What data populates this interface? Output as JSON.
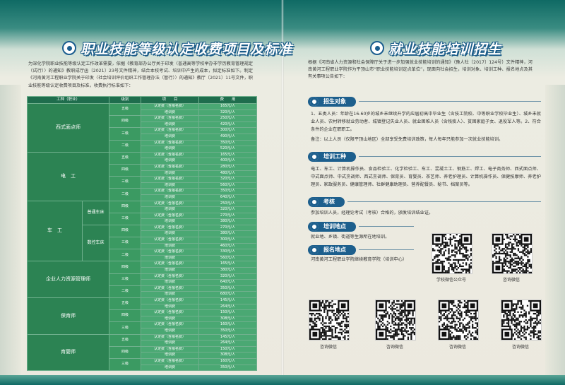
{
  "left": {
    "title": "职业技能等级认定收费项目及标准",
    "intro": "为深化学院职业技能等级认定工作改革需要，依据《教育部办公厅关于印发〈普通高等学校举办非学历教育管理规定（试行）〉的通知》教职成厅函〔2021〕23号文件精神，结合本校考试、培训中产生的成本，拟定标准如下。制定《河南黄河工程职业学院关于印发〈社会培训评价组织工作管理办法（暂行）〉的通知》教厅〔2021〕11号文件，职业技能等级认定收费项目及标准，收费执行标准如下：",
    "table": {
      "headers": [
        "工种（职业）",
        "级别",
        "项　　目",
        "费　　用"
      ],
      "groups": [
        {
          "type": "西式面点师",
          "levels": [
            {
              "level": "五级",
              "rows": [
                [
                  "认定费（含报名费）",
                  "165元/人"
                ],
                [
                  "培训费",
                  "320元/人"
                ]
              ]
            },
            {
              "level": "四级",
              "rows": [
                [
                  "认定费（含报名费）",
                  "250元/人"
                ],
                [
                  "培训费",
                  "420元/人"
                ]
              ]
            },
            {
              "level": "三级",
              "rows": [
                [
                  "认定费（含报名费）",
                  "300元/人"
                ],
                [
                  "培训费",
                  "490元/人"
                ]
              ]
            },
            {
              "level": "二级",
              "rows": [
                [
                  "认定费（含报名费）",
                  "350元/人"
                ],
                [
                  "培训费",
                  "520元/人"
                ]
              ]
            }
          ]
        },
        {
          "type": "电　工",
          "levels": [
            {
              "level": "五级",
              "rows": [
                [
                  "认定费（含报名费）",
                  "165元/人"
                ],
                [
                  "培训费",
                  "400元/人"
                ]
              ]
            },
            {
              "level": "四级",
              "rows": [
                [
                  "认定费（含报名费）",
                  "280元/人"
                ],
                [
                  "培训费",
                  "480元/人"
                ]
              ]
            },
            {
              "level": "三级",
              "rows": [
                [
                  "认定费（含报名费）",
                  "320元/人"
                ],
                [
                  "培训费",
                  "560元/人"
                ]
              ]
            },
            {
              "level": "二级",
              "rows": [
                [
                  "认定费（含报名费）",
                  "350元/人"
                ],
                [
                  "培训费",
                  "640元/人"
                ]
              ]
            }
          ]
        },
        {
          "type": "车　工",
          "subtypes": [
            {
              "sub": "普通车床",
              "levels": [
                {
                  "level": "四级",
                  "rows": [
                    [
                      "认定费（含报名费）",
                      "250元/人"
                    ],
                    [
                      "培训费",
                      "320元/人"
                    ]
                  ]
                },
                {
                  "level": "三级",
                  "rows": [
                    [
                      "认定费（含报名费）",
                      "270元/人"
                    ],
                    [
                      "培训费",
                      "380元/人"
                    ]
                  ]
                }
              ]
            },
            {
              "sub": "数控车床",
              "levels": [
                {
                  "level": "四级",
                  "rows": [
                    [
                      "认定费（含报名费）",
                      "270元/人"
                    ],
                    [
                      "培训费",
                      "380元/人"
                    ]
                  ]
                },
                {
                  "level": "三级",
                  "rows": [
                    [
                      "认定费（含报名费）",
                      "300元/人"
                    ],
                    [
                      "培训费",
                      "460元/人"
                    ]
                  ]
                },
                {
                  "level": "二级",
                  "rows": [
                    [
                      "认定费（含报名费）",
                      "330元/人"
                    ],
                    [
                      "培训费",
                      "560元/人"
                    ]
                  ]
                }
              ]
            }
          ]
        },
        {
          "type": "企业人力资源管理师",
          "levels": [
            {
              "level": "四级",
              "rows": [
                [
                  "认定费（含报名费）",
                  "165元/人"
                ],
                [
                  "培训费",
                  "380元/人"
                ]
              ]
            },
            {
              "level": "三级",
              "rows": [
                [
                  "认定费（含报名费）",
                  "320元/人"
                ],
                [
                  "培训费",
                  "640元/人"
                ]
              ]
            },
            {
              "level": "二级",
              "rows": [
                [
                  "认定费（含报名费）",
                  "350元/人"
                ],
                [
                  "培训费",
                  "680元/人"
                ]
              ]
            }
          ]
        },
        {
          "type": "保育师",
          "levels": [
            {
              "level": "五级",
              "rows": [
                [
                  "认定费（含报名费）",
                  "145元/人"
                ],
                [
                  "培训费",
                  "264元/人"
                ]
              ]
            },
            {
              "level": "四级",
              "rows": [
                [
                  "认定费（含报名费）",
                  "150元/人"
                ],
                [
                  "培训费",
                  "308元/人"
                ]
              ]
            },
            {
              "level": "三级",
              "rows": [
                [
                  "认定费（含报名费）",
                  "160元/人"
                ],
                [
                  "培训费",
                  "350元/人"
                ]
              ]
            }
          ]
        },
        {
          "type": "育婴师",
          "levels": [
            {
              "level": "五级",
              "rows": [
                [
                  "认定费（含报名费）",
                  "145元/人"
                ],
                [
                  "培训费",
                  "264元/人"
                ]
              ]
            },
            {
              "level": "四级",
              "rows": [
                [
                  "认定费（含报名费）",
                  "150元/人"
                ],
                [
                  "培训费",
                  "308元/人"
                ]
              ]
            },
            {
              "level": "三级",
              "rows": [
                [
                  "认定费（含报名费）",
                  "160元/人"
                ],
                [
                  "培训费",
                  "350元/人"
                ]
              ]
            }
          ]
        }
      ]
    }
  },
  "right": {
    "title": "就业技能培训招生",
    "intro": "根据《河南省人力资源和社会保障厅关于进一步加强就业技能培训的通知》（豫人社〔2017〕124号）文件精神，河南黄河工程职业学院作为平顶山市“职业技能培训定点单位”，现面向社会招生，培训对象、培训工种、报名地点及其有关事项公告如下：",
    "sections": {
      "recruit": {
        "label": "招生对象",
        "text": "1、五类人员：年龄在16-60岁的城乡未继续升学的应届初高中毕业生（含技工院校、中等职业学校毕业生）、城乡未就业人员、农村转移就业劳动者、城镇登记失业人员、就业困难人员（含残疾人）、贫困家庭子女、退役军人等。2、符合条件的企业在职职工。",
        "note": "备注：以上人员（仅限平顶山地区）全部享受免费培训政策，每人每年只能参加一次就业技能培训。"
      },
      "jobs": {
        "label": "培训工种",
        "text": "电工、车工、计算机操作员、食品检验工、化学检验工、车工、混凝土工、钢筋工、焊工、电子商务师、西式面点师、中式面点师、中式烹调师、西式烹调师、保育员、育婴员、茶艺师、养老护理员、计算机操作员、保健按摩师、养老护理员、家政服务员、健康管理师、社群健康助理员、营养配餐员、秘书、档案员等。"
      },
      "exam": {
        "label": "考核",
        "text": "参加培训人员，经理论考试（考核）合格的，颁发培训结业证。"
      },
      "location": {
        "label": "培训地点",
        "text": "就业地、乡镇、街道等生源所在地培训。"
      },
      "signup": {
        "label": "报名地点",
        "text": "河南黄河工程职业学院继续教育学院（培训中心）"
      }
    },
    "qr_captions": [
      "学校微信公众号",
      "咨询微信",
      "咨询微信",
      "咨询微信",
      "咨询微信",
      "咨询微信"
    ]
  }
}
